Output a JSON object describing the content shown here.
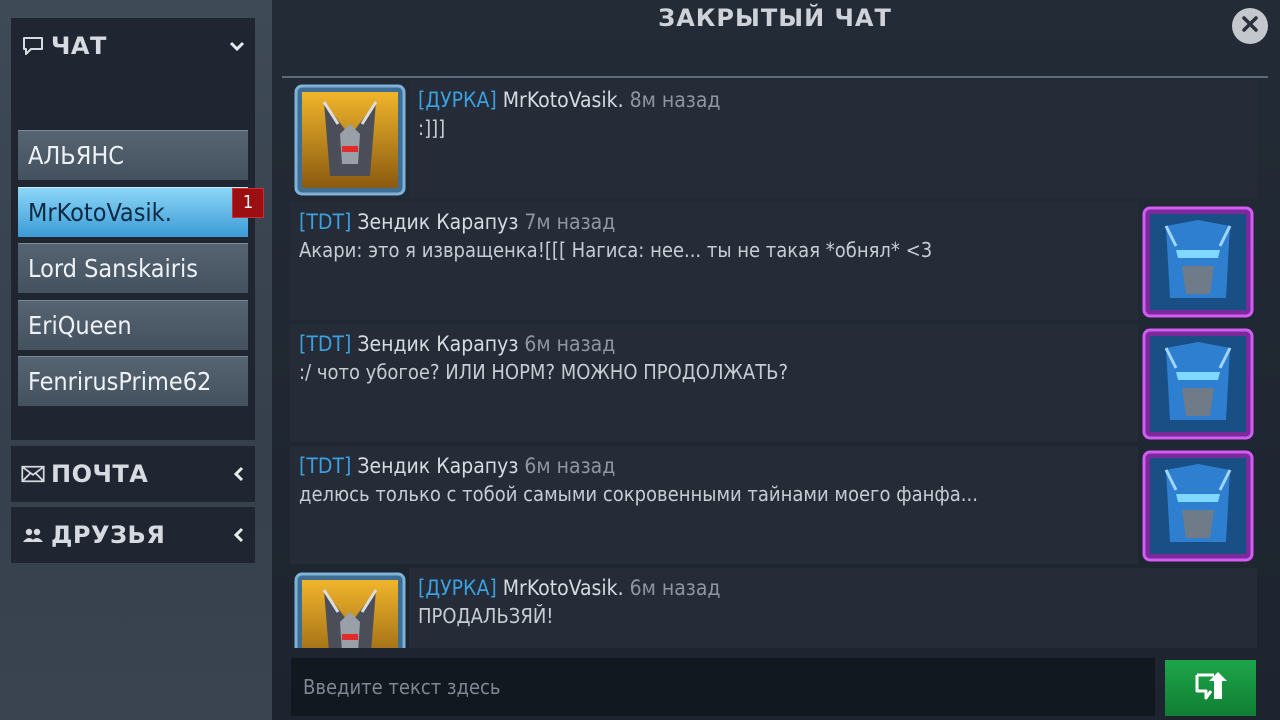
{
  "sidebar": {
    "chat_title": "ЧАТ",
    "chat_items": [
      {
        "label": "АЛЬЯНС",
        "active": false
      },
      {
        "label": "MrKotoVasik.",
        "active": true,
        "badge": "1"
      },
      {
        "label": "Lord Sanskairis",
        "active": false
      },
      {
        "label": "EriQueen",
        "active": false
      },
      {
        "label": "FenrirusPrime62",
        "active": false
      }
    ],
    "mail_title": "ПОЧТА",
    "friends_title": "ДРУЗЬЯ",
    "icons": {
      "chat": "speech-bubble-icon",
      "mail": "envelope-icon",
      "friends": "people-icon"
    }
  },
  "header": {
    "title": "ЗАКРЫТЫЙ ЧАТ"
  },
  "messages": [
    {
      "side": "left",
      "tag": "[ДУРКА]",
      "sender": "MrKotoVasik.",
      "time": "8м назад",
      "text": ":]]]",
      "avatar": "gold-robot"
    },
    {
      "side": "right",
      "tag": "[TDT]",
      "sender": "Зендик Карапуз",
      "time": "7м назад",
      "text": "Акари: это я извращенка![[[  Нагиса: нее... ты не такая *обнял* <3",
      "avatar": "blue-robot"
    },
    {
      "side": "right",
      "tag": "[TDT]",
      "sender": "Зендик Карапуз",
      "time": "6м назад",
      "text": ":/    чото убогое? ИЛИ НОРМ? МОЖНО ПРОДОЛЖАТЬ?",
      "avatar": "blue-robot"
    },
    {
      "side": "right",
      "tag": "[TDT]",
      "sender": "Зендик Карапуз",
      "time": "6м назад",
      "text": "делюсь только с тобой самыми сокровенными тайнами моего фанфа...",
      "avatar": "blue-robot"
    },
    {
      "side": "left",
      "tag": "[ДУРКА]",
      "sender": "MrKotoVasik.",
      "time": "6м назад",
      "text": "ПРОДАЛЬЗЯЙ!",
      "avatar": "gold-robot"
    }
  ],
  "input": {
    "placeholder": "Введите текст здесь",
    "value": ""
  },
  "colors": {
    "tag": "#3c9fe0",
    "active_item": "#4fb3e6",
    "send": "#1a9c45",
    "badge": "#9b0f12",
    "gold_frame": "#5c8fb5",
    "purple_frame": "#b23ee0"
  }
}
